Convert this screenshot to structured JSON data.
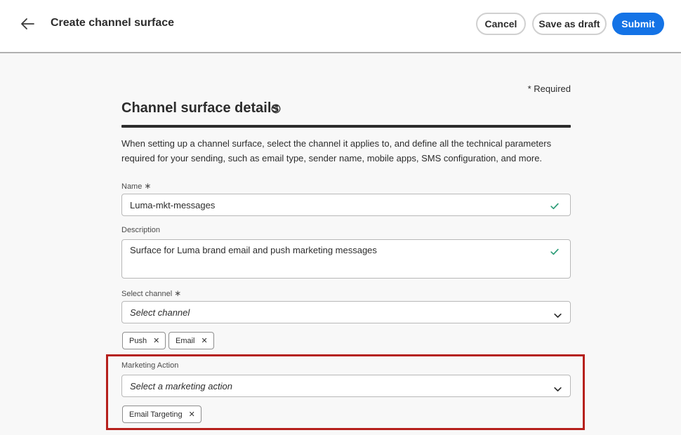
{
  "header": {
    "title": "Create channel surface",
    "cancel_label": "Cancel",
    "save_draft_label": "Save as draft",
    "submit_label": "Submit"
  },
  "form": {
    "required_note": "* Required",
    "section_title": "Channel surface details",
    "intro": "When setting up a channel surface, select the channel it applies to, and define all the technical parameters required for your sending, such as email type, sender name, mobile apps, SMS configuration, and more.",
    "name": {
      "label": "Name",
      "required_mark": "∗",
      "value": "Luma-mkt-messages"
    },
    "description": {
      "label": "Description",
      "value": "Surface for Luma brand email and push marketing messages"
    },
    "channel": {
      "label": "Select channel",
      "required_mark": "∗",
      "placeholder": "Select channel",
      "tags": [
        "Push",
        "Email"
      ]
    },
    "marketing_action": {
      "label": "Marketing Action",
      "placeholder": "Select a marketing action",
      "tags": [
        "Email Targeting"
      ]
    }
  },
  "colors": {
    "accent": "#1473e6",
    "valid_check": "#2d9d78",
    "highlight_border": "#b6201c"
  },
  "icons": {
    "back": "arrow-left-icon",
    "help": "help-circle-icon",
    "valid": "checkmark-icon",
    "dropdown": "chevron-down-icon",
    "remove_tag": "close-icon"
  }
}
